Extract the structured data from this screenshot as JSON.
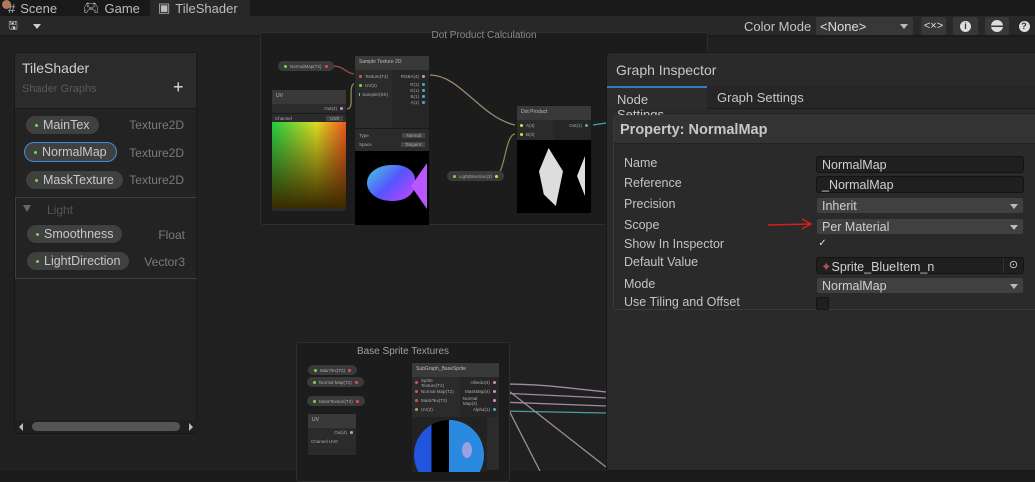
{
  "tabs": [
    {
      "label": "Scene",
      "icon": "grid-icon"
    },
    {
      "label": "Game",
      "icon": "gamepad-icon"
    },
    {
      "label": "TileShader",
      "icon": "shader-graph-icon"
    }
  ],
  "toolbar": {
    "color_mode_label": "Color Mode",
    "color_mode_value": "<None>",
    "buttons": [
      "save-icon",
      "dropdown-icon",
      "blackboard-toggle-icon",
      "info-icon",
      "preview-icon",
      "help-icon"
    ],
    "blackboard_symbol": "<×>"
  },
  "blackboard": {
    "title": "TileShader",
    "subtitle": "Shader Graphs",
    "add": "+",
    "properties": [
      {
        "name": "MainTex",
        "type": "Texture2D"
      },
      {
        "name": "NormalMap",
        "type": "Texture2D"
      },
      {
        "name": "MaskTexture",
        "type": "Texture2D"
      }
    ],
    "category": {
      "name": "Light",
      "properties": [
        {
          "name": "Smoothness",
          "type": "Float"
        },
        {
          "name": "LightDirection",
          "type": "Vector3"
        }
      ]
    }
  },
  "graph": {
    "group1": {
      "title": "Dot Product Calculation",
      "normal_pill": "NormalMap(T2)",
      "light_pill": "LightDirection(3)",
      "sample": {
        "title": "Sample Texture 2D",
        "inputs": [
          "Texture(T2)",
          "UV(2)",
          "Sampler(SS)"
        ],
        "outputs": [
          "RGBA(4)",
          "R(1)",
          "G(1)",
          "B(1)",
          "A(1)"
        ],
        "type_label": "Type",
        "type_value": "Normal",
        "space_label": "Space",
        "space_value": "Tangent"
      },
      "uv": {
        "title": "UV",
        "output": "Out(4)",
        "channel_label": "Channel",
        "channel_value": "UV0"
      },
      "dot": {
        "title": "Dot Product",
        "inputs": [
          "A(3)",
          "B(3)"
        ],
        "output": "Out(1)"
      }
    },
    "group2": {
      "title": "Base Sprite Textures",
      "pills": [
        "MainTex(T2)",
        "Normal Map(T2)",
        "MaskTexture(T2)"
      ],
      "sub": {
        "title": "SubGraph_BaseSprite",
        "inputs": [
          "Sprite Texture(T2)",
          "Normal Map(T2)",
          "MaskTex(T2)",
          "UV(2)"
        ],
        "outputs": [
          "Albedo(4)",
          "MaskMap(4)",
          "Normal Map(4)",
          "Alpha(1)"
        ]
      },
      "uv": {
        "title": "UV",
        "output": "Out(4)",
        "channel": "Channel UV0"
      }
    }
  },
  "inspector": {
    "title": "Graph Inspector",
    "tabs": [
      "Node Settings",
      "Graph Settings"
    ],
    "property_header": "Property: NormalMap",
    "fields": {
      "name_label": "Name",
      "name": "NormalMap",
      "reference_label": "Reference",
      "reference": "_NormalMap",
      "precision_label": "Precision",
      "precision": "Inherit",
      "scope_label": "Scope",
      "scope": "Per Material",
      "show_label": "Show In Inspector",
      "show": true,
      "default_label": "Default Value",
      "default": "Sprite_BlueItem_n",
      "mode_label": "Mode",
      "mode": "NormalMap",
      "tiling_label": "Use Tiling and Offset",
      "tiling": false
    }
  },
  "colors": {
    "accent": "#3a8fd8",
    "annotation_arrow": "#d42020",
    "property_dot": "#7bd54a"
  }
}
